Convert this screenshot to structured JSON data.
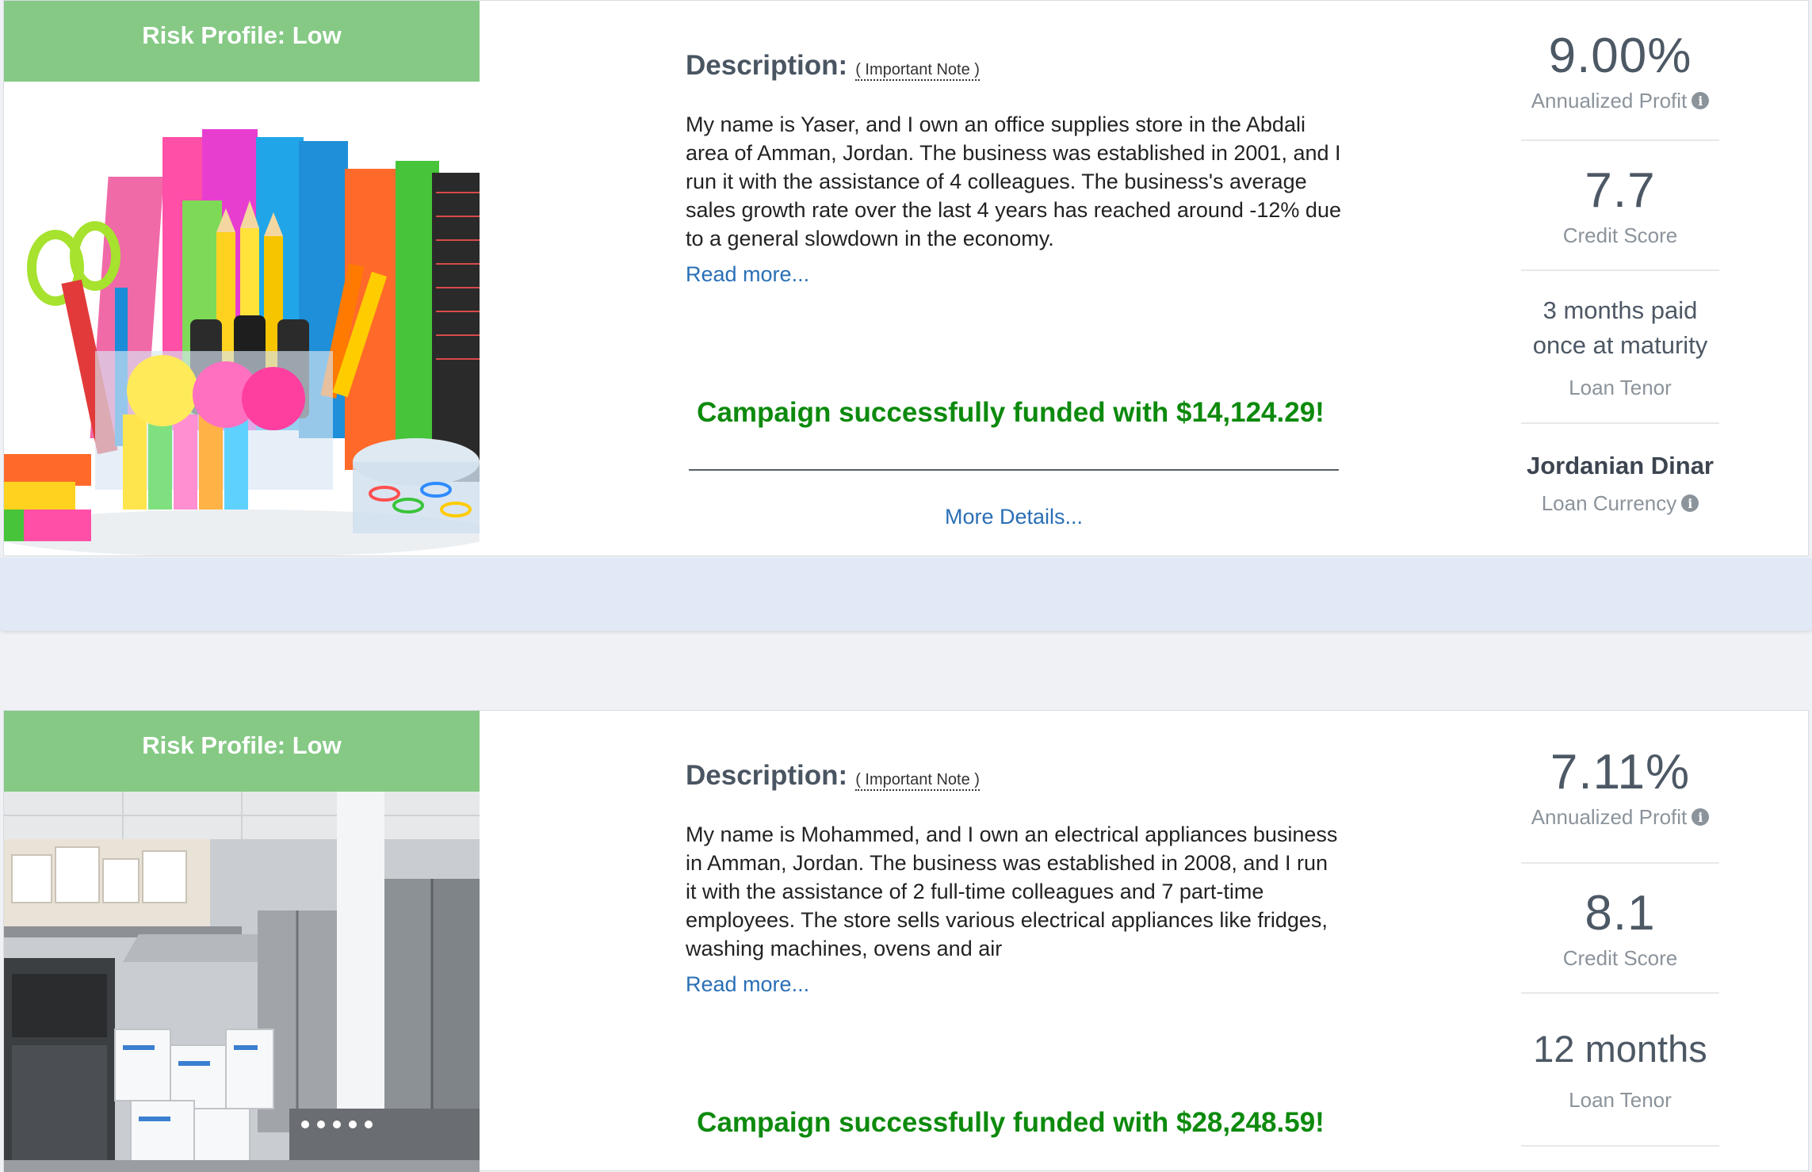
{
  "loans": [
    {
      "risk_profile": "Risk Profile: Low",
      "description_title": "Description:",
      "important_note": "( Important Note )",
      "description": "My name is Yaser, and I own an office supplies store in the Abdali area of Amman, Jordan. The business was established in 2001, and I run it with the assistance of 4 colleagues. The business's average sales growth rate over the last 4 years has reached around -12% due to a general slowdown in the economy.",
      "read_more": "Read more...",
      "funded_message": "Campaign successfully funded with $14,124.29!",
      "more_details": "More Details...",
      "annualized_profit": "9.00%",
      "annualized_profit_label": "Annualized Profit",
      "credit_score": "7.7",
      "credit_score_label": "Credit Score",
      "loan_tenor": "3 months paid once at maturity",
      "loan_tenor_label": "Loan Tenor",
      "loan_currency": "Jordanian Dinar",
      "loan_currency_label": "Loan Currency"
    },
    {
      "risk_profile": "Risk Profile: Low",
      "description_title": "Description:",
      "important_note": "( Important Note )",
      "description": "My name is Mohammed, and I own an electrical appliances business in Amman, Jordan. The business was established in 2008, and I run it with the assistance of 2 full-time colleagues and 7 part-time employees. The store sells various electrical appliances like fridges, washing machines, ovens and air",
      "read_more": "Read more...",
      "funded_message": "Campaign successfully funded with $28,248.59!",
      "annualized_profit": "7.11%",
      "annualized_profit_label": "Annualized Profit",
      "credit_score": "8.1",
      "credit_score_label": "Credit Score",
      "loan_tenor": "12 months",
      "loan_tenor_label": "Loan Tenor"
    }
  ],
  "icons": {
    "info": "info-icon"
  },
  "colors": {
    "risk_badge": "#85c985",
    "funded_text": "#0d8a0d",
    "link": "#2a6fb6",
    "footer_band": "#e1e9f6"
  }
}
